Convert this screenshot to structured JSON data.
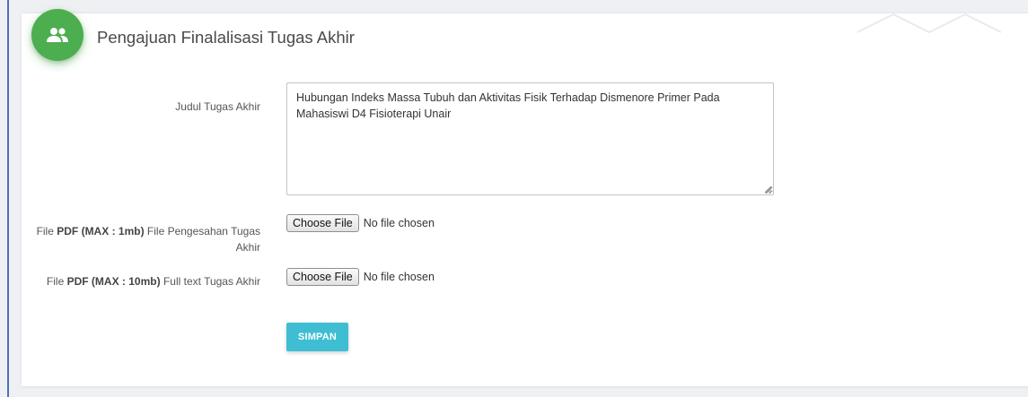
{
  "header": {
    "title": "Pengajuan Finalalisasi Tugas Akhir",
    "icon": "people-icon",
    "icon_color": "#4cae4f"
  },
  "form": {
    "title_label": "Judul Tugas Akhir",
    "title_value": "Hubungan Indeks Massa Tubuh dan Aktivitas Fisik Terhadap Dismenore Primer Pada Mahasiswi D4 Fisioterapi Unair",
    "file1": {
      "label_prefix": "File ",
      "label_bold": "PDF (MAX : 1mb)",
      "label_suffix": " File Pengesahan Tugas Akhir",
      "button_label": "Choose File",
      "status": "No file chosen"
    },
    "file2": {
      "label_prefix": "File ",
      "label_bold": "PDF (MAX : 10mb)",
      "label_suffix": " Full text Tugas Akhir",
      "button_label": "Choose File",
      "status": "No file chosen"
    },
    "submit_label": "SIMPAN",
    "submit_color": "#3fbed3"
  }
}
